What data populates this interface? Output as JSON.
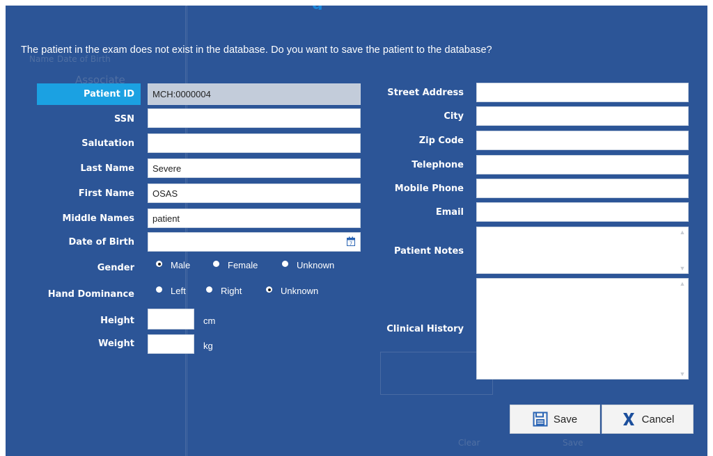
{
  "dialog": {
    "title_fragment": "g",
    "prompt": "The patient in the exam does not exist in the database. Do you want to save the patient to the database?"
  },
  "background_ghost": {
    "name_col": "Name",
    "dob_col": "Date of Birth",
    "associate": "Associate",
    "clear": "Clear",
    "save": "Save"
  },
  "left_form": {
    "patient_id": {
      "label": "Patient ID",
      "value": "MCH:0000004"
    },
    "ssn": {
      "label": "SSN",
      "value": ""
    },
    "salutation": {
      "label": "Salutation",
      "value": ""
    },
    "last_name": {
      "label": "Last Name",
      "value": "Severe"
    },
    "first_name": {
      "label": "First Name",
      "value": "OSAS"
    },
    "middle_names": {
      "label": "Middle Names",
      "value": "patient"
    },
    "date_of_birth": {
      "label": "Date of Birth",
      "value": ""
    },
    "gender": {
      "label": "Gender",
      "options": [
        "Male",
        "Female",
        "Unknown"
      ],
      "selected": "Male"
    },
    "hand_dominance": {
      "label": "Hand Dominance",
      "options": [
        "Left",
        "Right",
        "Unknown"
      ],
      "selected": "Unknown"
    },
    "height": {
      "label": "Height",
      "value": "",
      "unit": "cm"
    },
    "weight": {
      "label": "Weight",
      "value": "",
      "unit": "kg"
    }
  },
  "right_form": {
    "street_address": {
      "label": "Street Address",
      "value": ""
    },
    "city": {
      "label": "City",
      "value": ""
    },
    "zip_code": {
      "label": "Zip Code",
      "value": ""
    },
    "telephone": {
      "label": "Telephone",
      "value": ""
    },
    "mobile_phone": {
      "label": "Mobile Phone",
      "value": ""
    },
    "email": {
      "label": "Email",
      "value": ""
    },
    "patient_notes": {
      "label": "Patient Notes",
      "value": ""
    },
    "clinical_history": {
      "label": "Clinical History",
      "value": ""
    }
  },
  "buttons": {
    "save": "Save",
    "cancel": "Cancel"
  },
  "colors": {
    "dialog_bg": "#2c5597",
    "highlight_label": "#1ba1e2",
    "readonly_field": "#c3ccda",
    "cancel_icon": "#1c4f9c"
  }
}
